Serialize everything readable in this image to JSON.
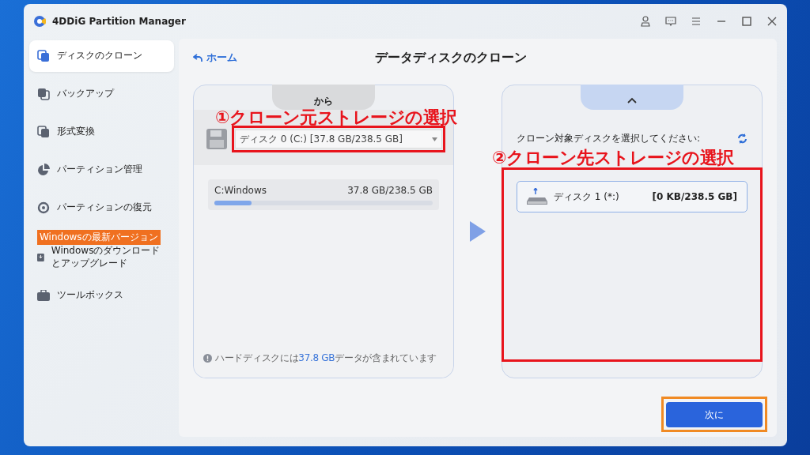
{
  "window": {
    "title": "4DDiG Partition Manager"
  },
  "sidebar": {
    "items": [
      {
        "label": "ディスクのクローン",
        "selected": true
      },
      {
        "label": "バックアップ",
        "selected": false
      },
      {
        "label": "形式変換",
        "selected": false
      },
      {
        "label": "パーティション管理",
        "selected": false
      },
      {
        "label": "パーティションの復元",
        "selected": false
      },
      {
        "label": "Windowsのダウンロードとアップグレード",
        "selected": false,
        "badge": "Windowsの最新バージョン"
      },
      {
        "label": "ツールボックス",
        "selected": false
      }
    ]
  },
  "main": {
    "back_link": "ホーム",
    "title": "データディスクのクローン"
  },
  "source": {
    "tab": "から",
    "dropdown": "ディスク 0 (C:) [37.8 GB/238.5 GB]",
    "partition": {
      "name": "C:Windows",
      "size": "37.8 GB/238.5 GB",
      "level": 0.17
    },
    "note_before": "ハードディスクには",
    "note_value": "37.8 GB",
    "note_after": "データが含まれています"
  },
  "target": {
    "prompt": "クローン対象ディスクを選択してください:",
    "disks": [
      {
        "name": "ディスク 1 (*:)",
        "size": "[0 KB/238.5 GB]"
      }
    ]
  },
  "next_button": "次に",
  "annotations": [
    {
      "text": "①クローン元ストレージの選択"
    },
    {
      "text": "②クローン先ストレージの選択"
    }
  ]
}
